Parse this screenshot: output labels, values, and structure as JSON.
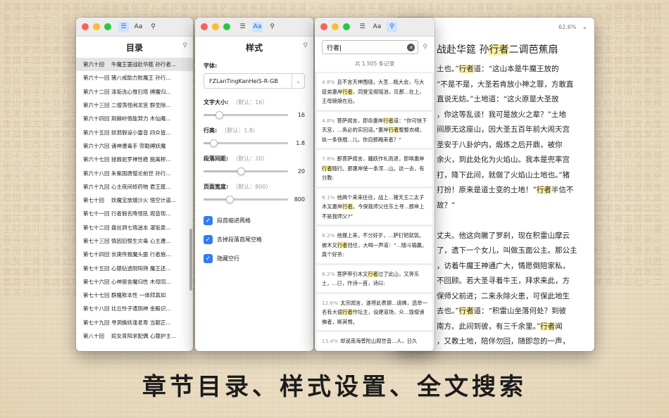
{
  "caption": "章节目录、样式设置、全文搜索",
  "colors": {
    "accent": "#2f7cf6",
    "highlight": "#fbf0a2"
  },
  "toolbar_icons": [
    "list-icon",
    "font-size-icon",
    "search-icon"
  ],
  "reader": {
    "zoom": "62.6%",
    "heading": "战赴华筵 孙行者二调芭蕉扇",
    "lines": [
      [
        "土也。”",
        "行者",
        "道：“这山本是牛魔王放的"
      ],
      [
        "“不是不是，大圣若肯放小神之罪，方敢直",
        "",
        ""
      ],
      [
        "直说无妨。”土地道：“这火原是大圣放",
        "",
        ""
      ],
      [
        "，你这等乱谈！我可是放火之辈？”土地",
        "",
        ""
      ],
      [
        "间原无这座山，因大圣五百年前大闹天宫",
        "",
        ""
      ],
      [
        "圣安于八卦炉内，煅炼之后开鼎，被你",
        "",
        ""
      ],
      [
        "余火，到此处化为火焰山。我本是兜率宫",
        "",
        ""
      ],
      [
        "打，降下此间，就做了火焰山土地也。”猪",
        "",
        ""
      ],
      [
        "打扮！原来是道士变的土地！”",
        "行者",
        "半信不"
      ],
      [
        "故？”",
        "",
        ""
      ],
      [
        "",
        "",
        ""
      ],
      [
        "丈夫。他这向撇了罗刹，现在积雷山摩云",
        "",
        ""
      ],
      [
        "了，遗下一个女儿，叫做玉面公主。那公主",
        "",
        ""
      ],
      [
        "，访着牛魔王神通广大，情愿倒陪家私，",
        "",
        ""
      ],
      [
        "不回顾。若大圣寻着牛王，拜求来此，方",
        "",
        ""
      ],
      [
        "保师父前进；二来永除火患，可保此地生",
        "",
        ""
      ],
      [
        "去也。”",
        "行者",
        "道：“积雷山坐落何处？到彼"
      ],
      [
        "南方。此间到彼，有三千余里。”",
        "行者",
        "闻"
      ],
      [
        "，又教土地，陪伴勿回，随即忽的一声，",
        "",
        ""
      ],
      [
        "一座高山凌汉。按落云头，停立巅峰之",
        "",
        ""
      ]
    ]
  },
  "toc": {
    "title": "目录",
    "items": [
      [
        "第六十回",
        "牛魔王罢战赴华筵 孙行者..."
      ],
      [
        "第六十一回",
        "猪八戒助力败魔王 孙行..."
      ],
      [
        "第六十二回",
        "涤垢洗心惟扫塔 缚魔归..."
      ],
      [
        "第六十三回",
        "二僧荡怪闹龙宫 群圣除..."
      ],
      [
        "第六十四回",
        "荆棘岭悟能努力 木仙庵..."
      ],
      [
        "第六十五回",
        "妖邪假设小雷音 四众皆..."
      ],
      [
        "第六十六回",
        "诸神遭毒手 弥勒缚妖魔"
      ],
      [
        "第六十七回",
        "拯救驼罗禅性稳 脱离秽..."
      ],
      [
        "第六十八回",
        "朱紫国唐僧论前世 孙行..."
      ],
      [
        "第六十九回",
        "心主夜间修药物 君王筵..."
      ],
      [
        "第七十回",
        "妖魔宝放烟沙火 悟空计盗..."
      ],
      [
        "第七十一回",
        "行者假名降怪犼 观音现..."
      ],
      [
        "第七十二回",
        "盘丝洞七情迷本 濯垢泉..."
      ],
      [
        "第七十三回",
        "情因旧恨生灾毒 心主遭..."
      ],
      [
        "第七十四回",
        "长庚传报魔头狠 行者施..."
      ],
      [
        "第七十五回",
        "心猿钻透阴阳窍 魔王还..."
      ],
      [
        "第七十六回",
        "心神居舍魔归性 木母同..."
      ],
      [
        "第七十七回",
        "群魔欺本性 一体拜真如"
      ],
      [
        "第七十八回",
        "比丘怜子遣阴神 金殿识..."
      ],
      [
        "第七十九回",
        "寻洞擒妖逢老寿 当朝正..."
      ],
      [
        "第八十回",
        "姹女育阳求配偶 心猿护主..."
      ]
    ]
  },
  "style": {
    "title": "样式",
    "font_label": "字体:",
    "font_value": "FZLanTingKanHeiS-R-GB",
    "sliders": [
      {
        "label": "文字大小:",
        "default": "（默认：16）",
        "value": "16",
        "level": 0.18
      },
      {
        "label": "行高:",
        "default": "（默认：1.8）",
        "value": "1.8",
        "level": 0.12
      },
      {
        "label": "段落间距:",
        "default": "（默认：20）",
        "value": "20",
        "level": 0.44
      },
      {
        "label": "页面宽度:",
        "default": "（默认：800）",
        "value": "800",
        "level": 0.31
      }
    ],
    "checks": [
      {
        "label": "段首缩进两格",
        "checked": true
      },
      {
        "label": "去掉段落首尾空格",
        "checked": true
      },
      {
        "label": "隐藏空行",
        "checked": true
      }
    ]
  },
  "search": {
    "query": "行者|",
    "count": "共 1,505 条记录",
    "results": [
      {
        "pct": "4.8%",
        "parts": [
          "且不言天神围绕，大圣...桃大会，与大徒弟惠岸",
          "行者",
          "，同登宝阁瑶池，见那...在上，王母娘娘在后。"
        ]
      },
      {
        "pct": "4.8%",
        "parts": [
          "菩萨闻言，即命惠岸",
          "行者",
          "道：“你可快下天宫，...务必的实回话。”惠岸",
          "行者",
          "整整衣裙，执一条铁棍...儿，你自那厢来者？”"
        ]
      },
      {
        "pct": "7.8%",
        "parts": [
          "那菩萨闻言，踊跃作礼而退，即唤惠岸",
          "行者",
          "随行。那惠岸使一条浑...山。这一去，有分教:"
        ]
      },
      {
        "pct": "8.1%",
        "parts": [
          "他两个来来往往，战上...猪天王二太子木叉惠岸",
          "行者",
          "。今保我师父往东土寻...那岸上不是我师父?”"
        ]
      },
      {
        "pct": "8.2%",
        "parts": [
          "他撞上来，不分好歹，...萨钉钯就筑。被木叉",
          "行者",
          "挡住，大喝一声道：“...随斗输赢。真个好杀:"
        ]
      },
      {
        "pct": "8.2%",
        "parts": [
          "菩萨带引木叉",
          "行者",
          "过了此山，又奔东土，...已，作诗一首，诗曰:"
        ]
      },
      {
        "pct": "12.6%",
        "parts": [
          "太宗闻言，遂将此表掷...请佛，选举一名有大德",
          "行者",
          "作坛主，设建道场，众...毁僧谤佛者，断其臂。"
        ]
      },
      {
        "pct": "13.4%",
        "parts": [
          "却说南海普陀山观世音...人，日久",
          "",
          ""
        ]
      }
    ]
  }
}
